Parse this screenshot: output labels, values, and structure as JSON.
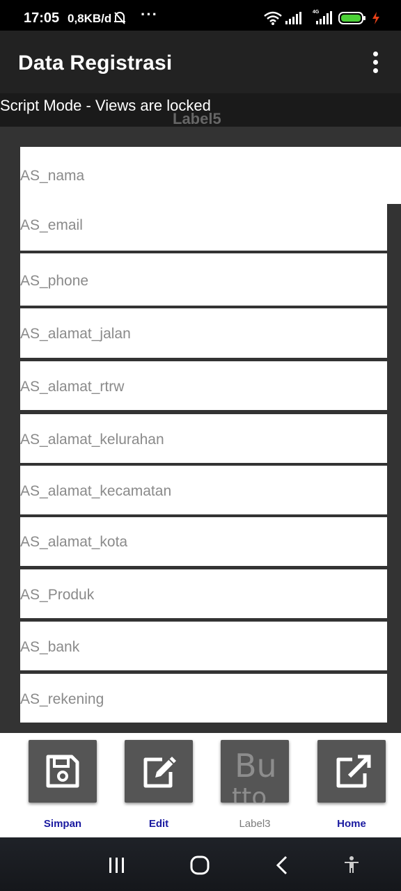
{
  "status_bar": {
    "time": "17:05",
    "speed": "0,8KB/d",
    "more": "···",
    "network_type": "4G",
    "icons": [
      "bell-off-icon",
      "wifi-icon",
      "signal-icon",
      "signal-4g-icon",
      "battery-icon",
      "charging-icon"
    ]
  },
  "app_bar": {
    "title": "Data Registrasi",
    "overflow_icon": "overflow-menu-icon"
  },
  "script_bar": {
    "message": "Script Mode - Views are locked",
    "label": "Label5"
  },
  "fields": [
    {
      "placeholder": "AS_nama"
    },
    {
      "placeholder": "AS_email"
    },
    {
      "placeholder": "AS_phone"
    },
    {
      "placeholder": "AS_alamat_jalan"
    },
    {
      "placeholder": "AS_alamat_rtrw"
    },
    {
      "placeholder": "AS_alamat_kelurahan"
    },
    {
      "placeholder": "AS_alamat_kecamatan"
    },
    {
      "placeholder": "AS_alamat_kota"
    },
    {
      "placeholder": "AS_Produk"
    },
    {
      "placeholder": "AS_bank"
    },
    {
      "placeholder": "AS_rekening"
    }
  ],
  "actions": [
    {
      "label": "Simpan",
      "icon": "save-icon"
    },
    {
      "label": "Edit",
      "icon": "edit-icon"
    },
    {
      "label": "Label3",
      "icon": "placeholder-button",
      "text": "Bu",
      "text2": "tto"
    },
    {
      "label": "Home",
      "icon": "open-external-icon"
    }
  ],
  "colors": {
    "status_bar": "#000000",
    "app_bar": "#222222",
    "background": "#333333",
    "button": "#555555",
    "button_label": "#1a1aa0",
    "battery": "#4cd137",
    "charging": "#e84118"
  }
}
